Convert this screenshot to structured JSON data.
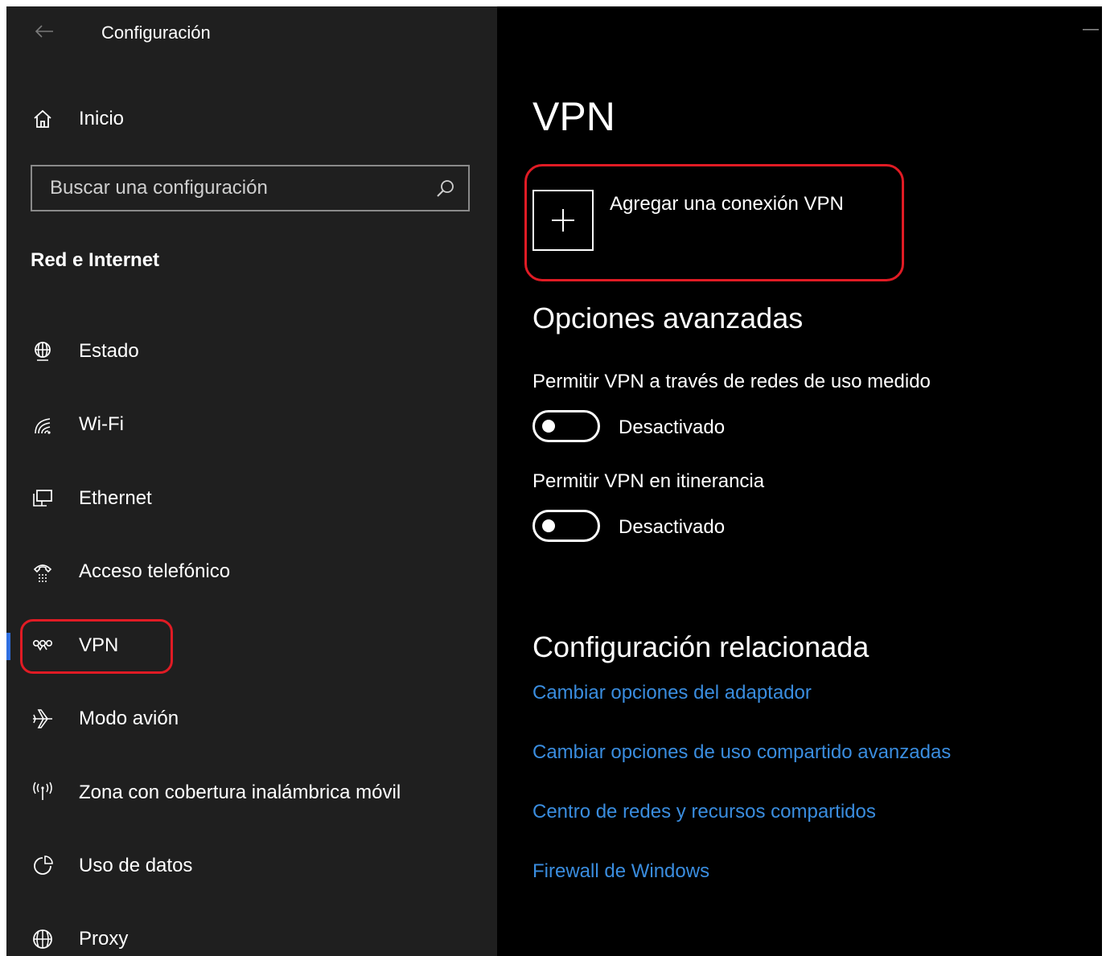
{
  "window": {
    "title": "Configuración",
    "back_icon": "back-arrow-icon",
    "minimize_label": "—"
  },
  "sidebar": {
    "home": {
      "label": "Inicio",
      "icon": "home-icon"
    },
    "search": {
      "placeholder": "Buscar una configuración",
      "value": "",
      "icon": "search-icon"
    },
    "section_title": "Red e Internet",
    "items": [
      {
        "label": "Estado",
        "icon": "network-status-icon"
      },
      {
        "label": "Wi-Fi",
        "icon": "wifi-icon"
      },
      {
        "label": "Ethernet",
        "icon": "ethernet-icon"
      },
      {
        "label": "Acceso telefónico",
        "icon": "dialup-icon"
      },
      {
        "label": "VPN",
        "icon": "vpn-icon",
        "selected": true
      },
      {
        "label": "Modo avión",
        "icon": "airplane-icon"
      },
      {
        "label": "Zona con cobertura inalámbrica móvil",
        "icon": "hotspot-icon"
      },
      {
        "label": "Uso de datos",
        "icon": "data-usage-icon"
      },
      {
        "label": "Proxy",
        "icon": "globe-icon"
      }
    ]
  },
  "main": {
    "title": "VPN",
    "add_vpn": {
      "label": "Agregar una conexión VPN",
      "icon": "plus-icon"
    },
    "advanced": {
      "heading": "Opciones avanzadas",
      "options": [
        {
          "label": "Permitir VPN a través de redes de uso medido",
          "state": "Desactivado",
          "on": false
        },
        {
          "label": "Permitir VPN en itinerancia",
          "state": "Desactivado",
          "on": false
        }
      ]
    },
    "related": {
      "heading": "Configuración relacionada",
      "links": [
        "Cambiar opciones del adaptador",
        "Cambiar opciones de uso compartido avanzadas",
        "Centro de redes y recursos compartidos",
        "Firewall de Windows"
      ]
    }
  },
  "colors": {
    "sidebar_bg": "#1f1f1f",
    "main_bg": "#000000",
    "accent": "#2f6fe0",
    "link": "#3a8ddf",
    "highlight": "#e01b24"
  }
}
